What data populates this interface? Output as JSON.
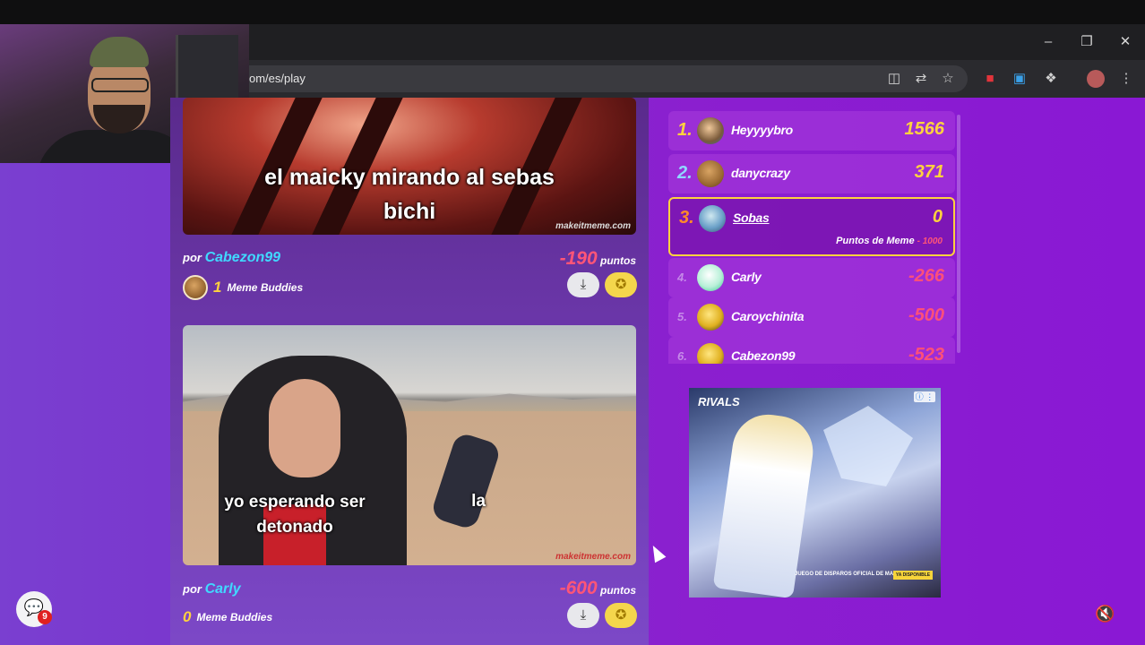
{
  "browser": {
    "url": "om/es/play",
    "window_controls": [
      "minimize-icon",
      "restore-icon",
      "close-icon"
    ],
    "toolbar_icons": [
      "install-app-icon",
      "translate-icon",
      "bookmark-star-icon",
      "extension-red-icon",
      "extension-blue-icon",
      "extensions-puzzle-icon",
      "profile-avatar",
      "more-menu-icon"
    ]
  },
  "feed": {
    "posts": [
      {
        "caption_lines": [
          "el maicky mirando al sebas",
          "bichi"
        ],
        "watermark": "makeitmeme.com",
        "by_label": "por",
        "author": "Cabezon99",
        "points": "-190",
        "points_label": "puntos",
        "buddies_count": "1",
        "buddies_label": "Meme Buddies"
      },
      {
        "caption_left": [
          "yo esperando ser",
          "detonado"
        ],
        "caption_right": "la",
        "watermark": "makeitmeme.com",
        "by_label": "por",
        "author": "Carly",
        "points": "-600",
        "points_label": "puntos",
        "buddies_count": "0",
        "buddies_label": "Meme Buddies"
      }
    ]
  },
  "leaderboard": {
    "rows": [
      {
        "rank": "1.",
        "name": "Heyyyybro",
        "score": "1566",
        "rank_color": "#ffd23e",
        "score_color": "#ffd23e"
      },
      {
        "rank": "2.",
        "name": "danycrazy",
        "score": "371",
        "rank_color": "#8fd8ff",
        "score_color": "#ffd23e"
      },
      {
        "rank": "3.",
        "name": "Sobas",
        "score": "0",
        "sub_label": "Puntos de Meme",
        "sub_value": "- 1000",
        "rank_color": "#ff8a2a",
        "score_color": "#ffd23e"
      },
      {
        "rank": "4.",
        "name": "Carly",
        "score": "-266",
        "rank_color": "#c58ae8",
        "score_color": "#ff4f7a"
      },
      {
        "rank": "5.",
        "name": "Caroychinita",
        "score": "-500",
        "rank_color": "#c58ae8",
        "score_color": "#ff4f7a"
      },
      {
        "rank": "6.",
        "name": "Cabezon99",
        "score": "-523",
        "rank_color": "#c58ae8",
        "score_color": "#ff4f7a"
      }
    ]
  },
  "ad": {
    "logo": "RIVALS",
    "tagline": "JUEGO DE DISPAROS OFICIAL DE MARVEL",
    "cta": "YA DISPONIBLE",
    "info": "ⓘ ⋮"
  },
  "chat": {
    "badge": "9"
  },
  "colors": {
    "accent_cyan": "#40d9ff",
    "gold": "#ffd23e",
    "negative": "#ff5577"
  }
}
